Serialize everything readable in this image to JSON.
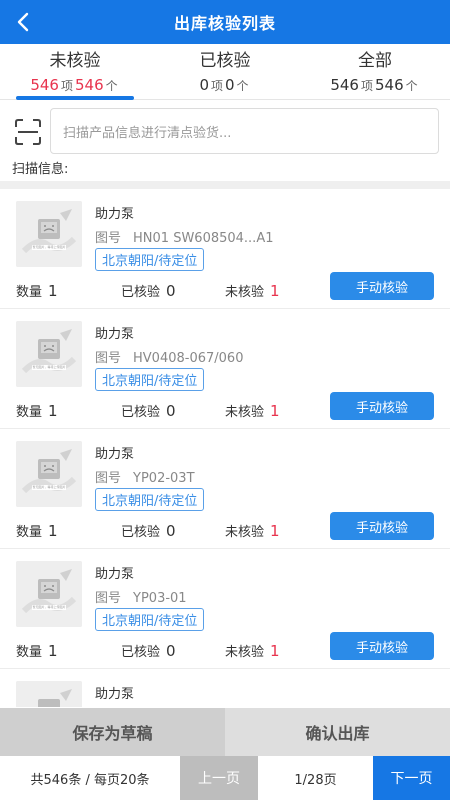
{
  "header": {
    "title": "出库核验列表",
    "back_icon": "chevron-left-icon"
  },
  "tabs": [
    {
      "label": "未核验",
      "items": "546",
      "items_unit": "项",
      "pieces": "546",
      "pieces_unit": "个",
      "active": true
    },
    {
      "label": "已核验",
      "items": "0",
      "items_unit": "项",
      "pieces": "0",
      "pieces_unit": "个",
      "active": false
    },
    {
      "label": "全部",
      "items": "546",
      "items_unit": "项",
      "pieces": "546",
      "pieces_unit": "个",
      "active": false
    }
  ],
  "scan": {
    "icon": "scan-icon",
    "placeholder": "扫描产品信息进行清点验货...",
    "info_label": "扫描信息:"
  },
  "placeholder_image": {
    "caption": "暂无图片，等待上传图片"
  },
  "items": [
    {
      "name": "助力泵",
      "drawing_label": "图号",
      "drawing_no": "HN01 SW608504...A1",
      "location": "北京朝阳/待定位",
      "qty_label": "数量",
      "qty": "1",
      "checked_label": "已核验",
      "checked": "0",
      "unchecked_label": "未核验",
      "unchecked": "1",
      "action": "手动核验"
    },
    {
      "name": "助力泵",
      "drawing_label": "图号",
      "drawing_no": "HV0408-067/060",
      "location": "北京朝阳/待定位",
      "qty_label": "数量",
      "qty": "1",
      "checked_label": "已核验",
      "checked": "0",
      "unchecked_label": "未核验",
      "unchecked": "1",
      "action": "手动核验"
    },
    {
      "name": "助力泵",
      "drawing_label": "图号",
      "drawing_no": "YP02-03T",
      "location": "北京朝阳/待定位",
      "qty_label": "数量",
      "qty": "1",
      "checked_label": "已核验",
      "checked": "0",
      "unchecked_label": "未核验",
      "unchecked": "1",
      "action": "手动核验"
    },
    {
      "name": "助力泵",
      "drawing_label": "图号",
      "drawing_no": "YP03-01",
      "location": "北京朝阳/待定位",
      "qty_label": "数量",
      "qty": "1",
      "checked_label": "已核验",
      "checked": "0",
      "unchecked_label": "未核验",
      "unchecked": "1",
      "action": "手动核验"
    },
    {
      "name": "助力泵"
    }
  ],
  "actions": {
    "save_draft": "保存为草稿",
    "confirm": "确认出库"
  },
  "pager": {
    "summary": "共546条 / 每页20条",
    "prev": "上一页",
    "page": "1/28页",
    "next": "下一页"
  },
  "colors": {
    "primary": "#1677e4",
    "danger": "#e8344e",
    "tag": "#3a8ee6"
  }
}
